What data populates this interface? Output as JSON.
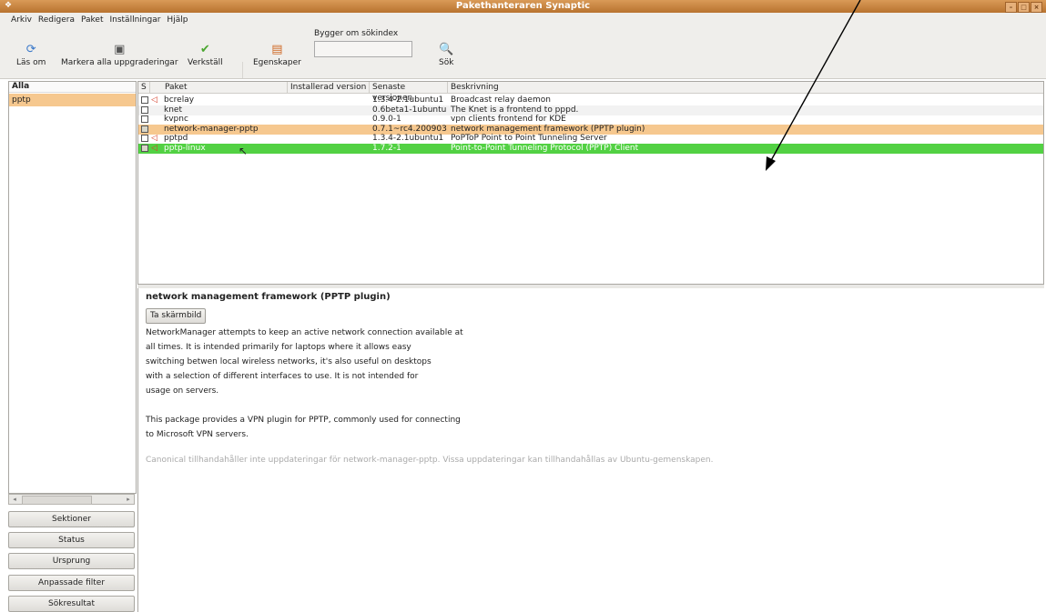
{
  "window": {
    "title": "Pakethanteraren Synaptic"
  },
  "menubar": [
    "Arkiv",
    "Redigera",
    "Paket",
    "Inställningar",
    "Hjälp"
  ],
  "toolbar": {
    "reload": "Läs om",
    "mark_all": "Markera alla uppgraderingar",
    "apply": "Verkställ",
    "properties": "Egenskaper",
    "search_label": "Bygger om sökindex",
    "search": "Sök"
  },
  "filter_list": {
    "header": "Alla",
    "items": [
      "pptp"
    ]
  },
  "filter_buttons": [
    "Sektioner",
    "Status",
    "Ursprung",
    "Anpassade filter",
    "Sökresultat"
  ],
  "columns": [
    "S",
    "Paket",
    "Installerad version",
    "Senaste versionen",
    "Beskrivning"
  ],
  "packages": [
    {
      "name": "bcrelay",
      "installed": "",
      "latest": "1.3.4-2.1ubuntu1",
      "description": "Broadcast relay daemon",
      "state": "unchecked",
      "ubuntu": true
    },
    {
      "name": "knet",
      "installed": "",
      "latest": "0.6beta1-1ubuntu1",
      "description": "The Knet is a frontend to pppd.",
      "state": "unchecked",
      "ubuntu": false
    },
    {
      "name": "kvpnc",
      "installed": "",
      "latest": "0.9.0-1",
      "description": "vpn clients frontend for KDE",
      "state": "unchecked",
      "ubuntu": false
    },
    {
      "name": "network-manager-pptp",
      "installed": "",
      "latest": "0.7.1~rc4.2009031(",
      "description": "network management framework (PPTP plugin)",
      "state": "marked",
      "ubuntu": false
    },
    {
      "name": "pptpd",
      "installed": "",
      "latest": "1.3.4-2.1ubuntu1",
      "description": "PoPToP Point to Point Tunneling Server",
      "state": "unchecked",
      "ubuntu": true
    },
    {
      "name": "pptp-linux",
      "installed": "",
      "latest": "1.7.2-1",
      "description": "Point-to-Point Tunneling Protocol (PPTP) Client",
      "state": "marked",
      "ubuntu": true
    }
  ],
  "details": {
    "title": "network management framework (PPTP plugin)",
    "screenshot_button": "Ta skärmbild",
    "lines": [
      "NetworkManager attempts to keep an active network connection available at",
      "all times.  It is intended primarily for laptops where it allows easy",
      "switching betwen local wireless networks, it's also useful on desktops",
      "with a selection of different interfaces to use.  It is not intended for",
      "usage on servers.",
      "",
      "This package provides a VPN plugin for PPTP, commonly used for connecting",
      "to Microsoft VPN servers."
    ],
    "note": "Canonical tillhandahåller inte uppdateringar för network-manager-pptp. Vissa uppdateringar kan tillhandahållas av Ubuntu-gemenskapen."
  },
  "colors": {
    "selected_row": "#f6c88f",
    "highlight_row": "#52d143",
    "titlebar": "#c8843f"
  }
}
